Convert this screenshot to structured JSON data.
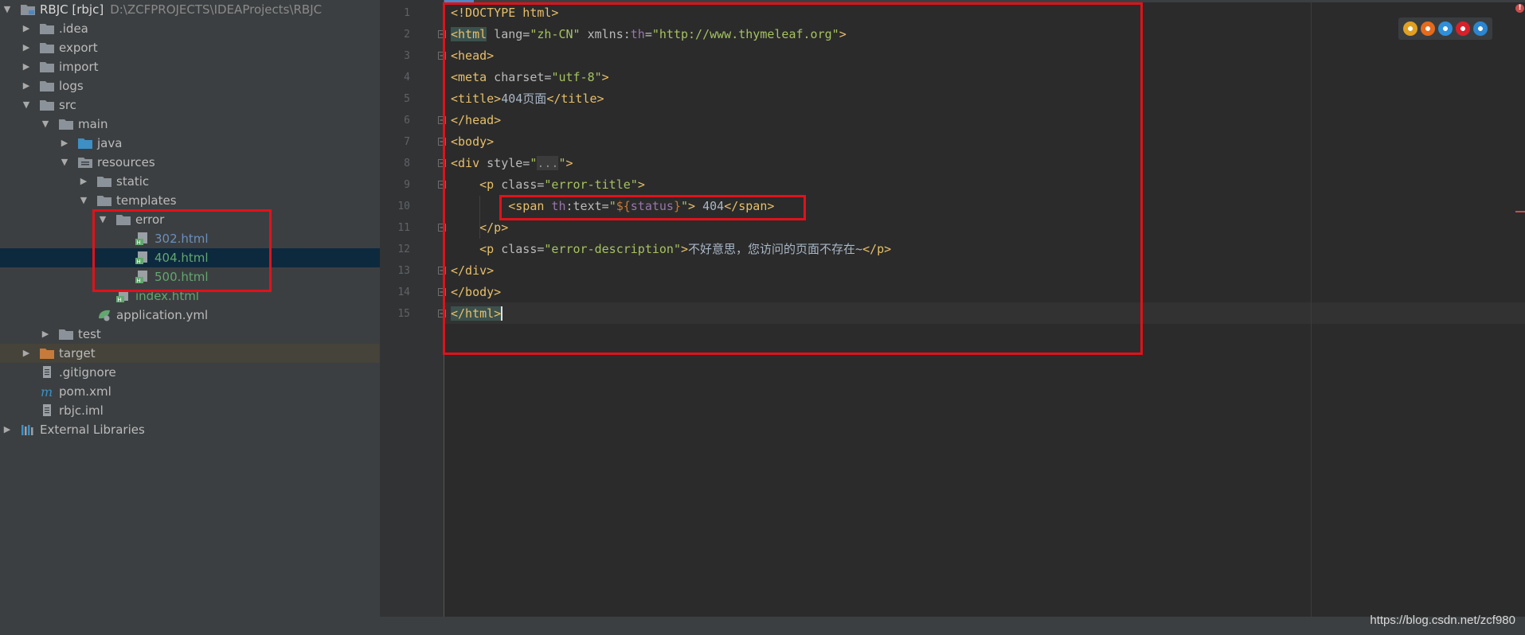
{
  "project_tree": {
    "root": {
      "label": "RBJC [rbjc]",
      "path": "D:\\ZCFPROJECTS\\IDEAProjects\\RBJC"
    },
    "items": [
      {
        "label": ".idea",
        "kind": "folder",
        "depth": 1,
        "arrow": "collapsed"
      },
      {
        "label": "export",
        "kind": "folder",
        "depth": 1,
        "arrow": "collapsed"
      },
      {
        "label": "import",
        "kind": "folder",
        "depth": 1,
        "arrow": "collapsed"
      },
      {
        "label": "logs",
        "kind": "folder",
        "depth": 1,
        "arrow": "collapsed"
      },
      {
        "label": "src",
        "kind": "folder",
        "depth": 1,
        "arrow": "expanded"
      },
      {
        "label": "main",
        "kind": "folder",
        "depth": 2,
        "arrow": "expanded"
      },
      {
        "label": "java",
        "kind": "source-folder",
        "depth": 3,
        "arrow": "collapsed"
      },
      {
        "label": "resources",
        "kind": "resources-folder",
        "depth": 3,
        "arrow": "expanded"
      },
      {
        "label": "static",
        "kind": "folder",
        "depth": 4,
        "arrow": "collapsed"
      },
      {
        "label": "templates",
        "kind": "folder",
        "depth": 4,
        "arrow": "expanded"
      },
      {
        "label": "error",
        "kind": "folder",
        "depth": 5,
        "arrow": "expanded"
      },
      {
        "label": "302.html",
        "kind": "html",
        "depth": 6,
        "arrow": "none"
      },
      {
        "label": "404.html",
        "kind": "html",
        "depth": 6,
        "arrow": "none",
        "selected": true
      },
      {
        "label": "500.html",
        "kind": "html",
        "depth": 6,
        "arrow": "none",
        "green": true
      },
      {
        "label": "index.html",
        "kind": "html",
        "depth": 5,
        "arrow": "none",
        "green": true
      },
      {
        "label": "application.yml",
        "kind": "yml",
        "depth": 4,
        "arrow": "none"
      },
      {
        "label": "test",
        "kind": "folder",
        "depth": 2,
        "arrow": "collapsed"
      },
      {
        "label": "target",
        "kind": "excluded-folder",
        "depth": 1,
        "arrow": "collapsed",
        "excluded": true
      },
      {
        "label": ".gitignore",
        "kind": "file",
        "depth": 1,
        "arrow": "none"
      },
      {
        "label": "pom.xml",
        "kind": "maven",
        "depth": 1,
        "arrow": "none"
      },
      {
        "label": "rbjc.iml",
        "kind": "file",
        "depth": 1,
        "arrow": "none"
      },
      {
        "label": "External Libraries",
        "kind": "libraries",
        "depth": 0,
        "arrow": "collapsed"
      }
    ]
  },
  "editor": {
    "line_numbers": [
      "1",
      "2",
      "3",
      "4",
      "5",
      "6",
      "7",
      "8",
      "9",
      "10",
      "11",
      "12",
      "13",
      "14",
      "15"
    ],
    "lines": [
      {
        "tokens": [
          {
            "t": "<!DOCTYPE html>",
            "c": "doctype"
          }
        ]
      },
      {
        "tokens": [
          {
            "t": "<",
            "c": "tag hl"
          },
          {
            "t": "html",
            "c": "tag hl"
          },
          {
            "t": " lang=",
            "c": "attr"
          },
          {
            "t": "\"zh-CN\"",
            "c": "val"
          },
          {
            "t": " xmlns:",
            "c": "attr"
          },
          {
            "t": "th",
            "c": "ns"
          },
          {
            "t": "=",
            "c": "attr"
          },
          {
            "t": "\"http://www.thymeleaf.org\"",
            "c": "val"
          },
          {
            "t": ">",
            "c": "tag"
          }
        ]
      },
      {
        "tokens": [
          {
            "t": "<head>",
            "c": "tag"
          }
        ]
      },
      {
        "tokens": [
          {
            "t": "<meta",
            "c": "tag"
          },
          {
            "t": " charset=",
            "c": "attr"
          },
          {
            "t": "\"utf-8\"",
            "c": "val"
          },
          {
            "t": ">",
            "c": "tag"
          }
        ]
      },
      {
        "tokens": [
          {
            "t": "<title>",
            "c": "tag"
          },
          {
            "t": "404页面",
            "c": "text"
          },
          {
            "t": "</title>",
            "c": "tag"
          }
        ]
      },
      {
        "tokens": [
          {
            "t": "</head>",
            "c": "tag"
          }
        ]
      },
      {
        "tokens": [
          {
            "t": "<body>",
            "c": "tag"
          }
        ]
      },
      {
        "tokens": [
          {
            "t": "<div",
            "c": "tag"
          },
          {
            "t": " style=",
            "c": "attr"
          },
          {
            "t": "\"",
            "c": "val"
          },
          {
            "t": "...",
            "c": "fold"
          },
          {
            "t": "\"",
            "c": "val"
          },
          {
            "t": ">",
            "c": "tag"
          }
        ]
      },
      {
        "tokens": [
          {
            "t": "    <p",
            "c": "tag"
          },
          {
            "t": " class=",
            "c": "attr"
          },
          {
            "t": "\"error-title\"",
            "c": "val"
          },
          {
            "t": ">",
            "c": "tag"
          }
        ]
      },
      {
        "tokens": [
          {
            "t": "        <span",
            "c": "tag"
          },
          {
            "t": " th",
            "c": "ns"
          },
          {
            "t": ":text=",
            "c": "attr"
          },
          {
            "t": "\"",
            "c": "val"
          },
          {
            "t": "${",
            "c": "expr"
          },
          {
            "t": "status",
            "c": "ns"
          },
          {
            "t": "}",
            "c": "expr"
          },
          {
            "t": "\"",
            "c": "val"
          },
          {
            "t": ">",
            "c": "tag"
          },
          {
            "t": " 404",
            "c": "text"
          },
          {
            "t": "</span>",
            "c": "tag"
          }
        ]
      },
      {
        "tokens": [
          {
            "t": "    </p>",
            "c": "tag"
          }
        ]
      },
      {
        "tokens": [
          {
            "t": "    <p",
            "c": "tag"
          },
          {
            "t": " class=",
            "c": "attr"
          },
          {
            "t": "\"error-description\"",
            "c": "val"
          },
          {
            "t": ">",
            "c": "tag"
          },
          {
            "t": "不好意思，您访问的页面不存在~",
            "c": "text"
          },
          {
            "t": "</p>",
            "c": "tag"
          }
        ]
      },
      {
        "tokens": [
          {
            "t": "</div>",
            "c": "tag"
          }
        ]
      },
      {
        "tokens": [
          {
            "t": "</body>",
            "c": "tag"
          }
        ]
      },
      {
        "tokens": [
          {
            "t": "</html>",
            "c": "tag hl caret"
          }
        ]
      }
    ]
  },
  "browser_icons": [
    {
      "name": "chrome-icon",
      "color": "#e0a020"
    },
    {
      "name": "firefox-icon",
      "color": "#e46a1c"
    },
    {
      "name": "safari-icon",
      "color": "#2f8fd9"
    },
    {
      "name": "opera-icon",
      "color": "#d8202a"
    },
    {
      "name": "ie-icon",
      "color": "#2a86d1"
    }
  ],
  "status": {
    "error_marker": "!"
  },
  "watermark": "https://blog.csdn.net/zcf980",
  "colors": {
    "highlight_box": "#e0121a",
    "selection": "#0d293e",
    "folder": "#8b929a"
  }
}
